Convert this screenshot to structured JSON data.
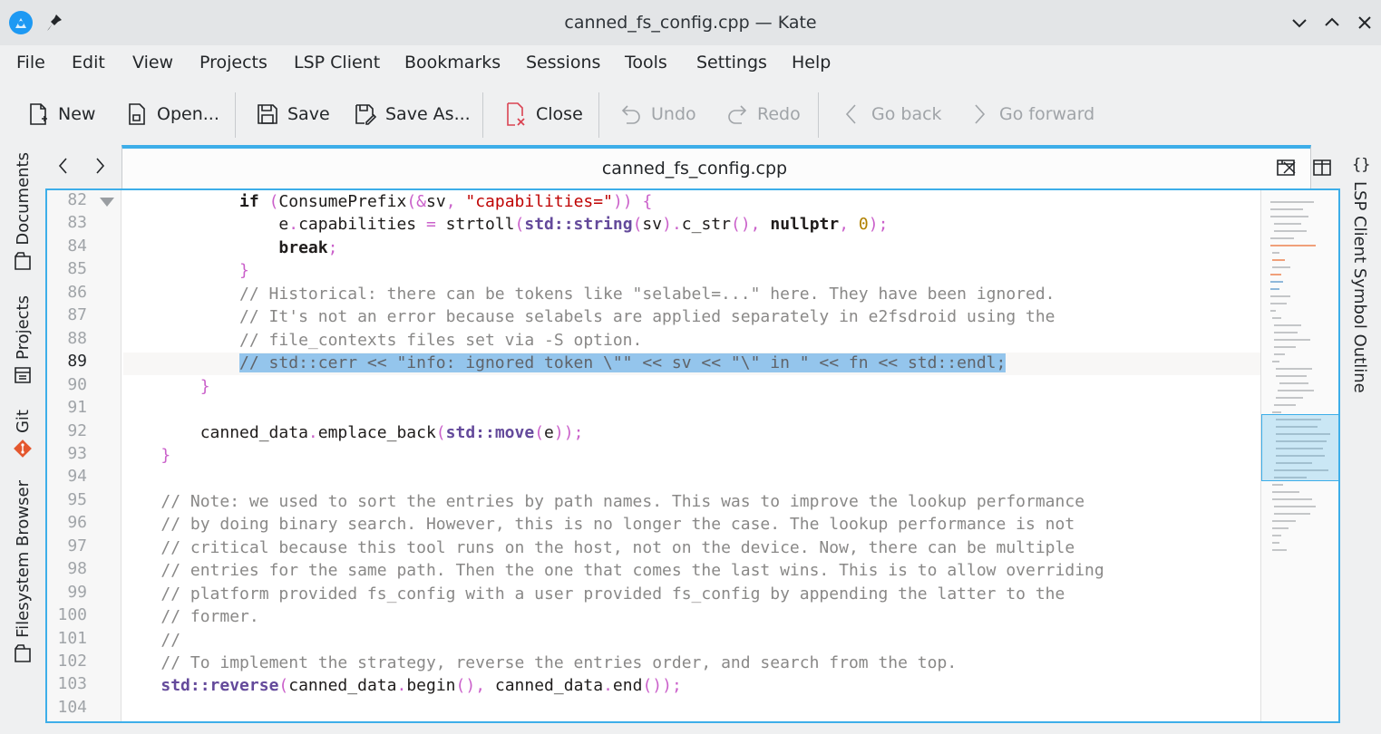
{
  "window": {
    "title": "canned_fs_config.cpp — Kate"
  },
  "menu": [
    "File",
    "Edit",
    "View",
    "Projects",
    "LSP Client",
    "Bookmarks",
    "Sessions",
    "Tools",
    "Settings",
    "Help"
  ],
  "toolbar": {
    "new": "New",
    "open": "Open...",
    "save": "Save",
    "save_as": "Save As...",
    "close": "Close",
    "undo": "Undo",
    "redo": "Redo",
    "go_back": "Go back",
    "go_forward": "Go forward"
  },
  "left_panels": [
    "Documents",
    "Projects",
    "Git",
    "Filesystem Browser"
  ],
  "right_panel": "LSP Client Symbol Outline",
  "tab": {
    "name": "canned_fs_config.cpp"
  },
  "editor": {
    "current_line": 89,
    "line_numbers": [
      "82",
      "83",
      "84",
      "85",
      "86",
      "87",
      "88",
      "89",
      "90",
      "91",
      "92",
      "93",
      "94",
      "95",
      "96",
      "97",
      "98",
      "99",
      "100",
      "101",
      "102",
      "103",
      "104"
    ],
    "lines": [
      "            if (ConsumePrefix(&sv, \"capabilities=\")) {",
      "                e.capabilities = strtoll(std::string(sv).c_str(), nullptr, 0);",
      "                break;",
      "            }",
      "            // Historical: there can be tokens like \"selabel=...\" here. They have been ignored.",
      "            // It's not an error because selabels are applied separately in e2fsdroid using the",
      "            // file_contexts files set via -S option.",
      "            // std::cerr << \"info: ignored token \\\"\" << sv << \"\\\" in \" << fn << std::endl;",
      "        }",
      "",
      "        canned_data.emplace_back(std::move(e));",
      "    }",
      "",
      "    // Note: we used to sort the entries by path names. This was to improve the lookup performance",
      "    // by doing binary search. However, this is no longer the case. The lookup performance is not",
      "    // critical because this tool runs on the host, not on the device. Now, there can be multiple",
      "    // entries for the same path. Then the one that comes the last wins. This is to allow overriding",
      "    // platform provided fs_config with a user provided fs_config by appending the latter to the",
      "    // former.",
      "    //",
      "    // To implement the strategy, reverse the entries order, and search from the top.",
      "    std::reverse(canned_data.begin(), canned_data.end());",
      ""
    ]
  },
  "colors": {
    "accent": "#3daee9",
    "selection": "#94c5ec",
    "string": "#bf0303",
    "comment": "#898887",
    "namespace": "#644a9b",
    "operator": "#ca60ca",
    "number": "#b08000"
  }
}
